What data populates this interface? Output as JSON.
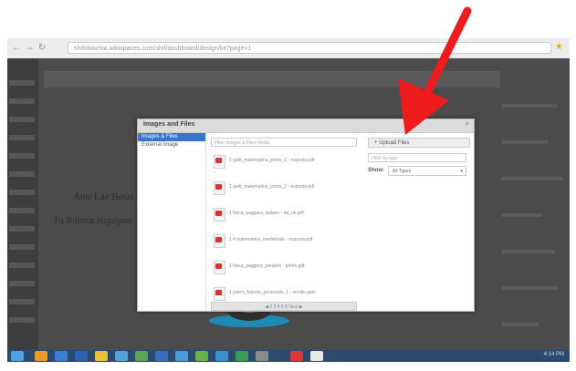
{
  "browser": {
    "url": "shifsblachia.wikispaces.com/shif/dashboard/design/kit?page=1",
    "nav_back": "←",
    "nav_forward": "→",
    "nav_reload": "↻",
    "bookmark_star": "★"
  },
  "page": {
    "ghost_line_1": "Ahir Lae Besai",
    "ghost_line_2": "Tu Iblinca sugsipan"
  },
  "dialog": {
    "title": "Images and Files",
    "close": "×",
    "sidebar_items": [
      {
        "label": "Images & Files",
        "active": true
      },
      {
        "label": "External Image",
        "active": false
      }
    ],
    "search_placeholder": "Filter Images & Files Media",
    "files": [
      "1 gadi_matematica_primo_1 - risposta.pdf",
      "1 gadi_matematica_primo_2 - risposta.pdf",
      "1 fisica_paggara_italiano - da_ok.pdf",
      "1 4 matematica_medicinale - risposta.pdf",
      "1 fisica_paggara_paraloni - primo.pdf",
      "1 parco_foresta_personale_1 - scrollo.pptx"
    ],
    "pager": "◀  2  3  4  5  6  Next ▶",
    "upload_label": "+ Upload Files",
    "filter_placeholder": "Filter by tags",
    "show_label": "Show:",
    "show_value": "All Types"
  },
  "taskbar": {
    "clock": "4:14 PM"
  },
  "colors": {
    "arrow": "#ee1c1c",
    "dialog_accent": "#3b73c9",
    "taskbar": "#2c4a6e"
  }
}
